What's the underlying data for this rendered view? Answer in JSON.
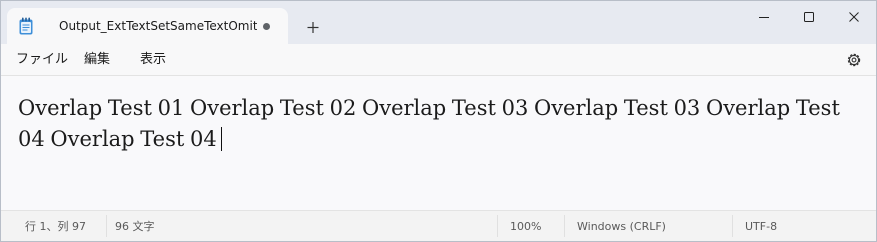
{
  "window": {
    "tab_title": "Output_ExtTextSetSameTextOmitRa",
    "new_tab_symbol": "+",
    "modified_indicator": "unsaved-dot"
  },
  "menu": {
    "items": [
      "ファイル",
      "編集",
      "表示"
    ]
  },
  "editor": {
    "content": "Overlap Test 01 Overlap Test 02 Overlap Test 03 Overlap Test 03 Overlap Test 04 Overlap Test 04"
  },
  "status": {
    "position": "行 1、列 97",
    "char_count": "96 文字",
    "zoom": "100%",
    "line_ending": "Windows (CRLF)",
    "encoding": "UTF-8"
  },
  "icons": {
    "app": "notepad-icon",
    "minimize": "minimize-icon",
    "maximize": "maximize-icon",
    "close": "close-icon",
    "settings": "gear-icon"
  },
  "colors": {
    "titlebar": "#e7eaf1",
    "tab": "#f8f8f9",
    "editor_bg": "#f9f9fb",
    "statusbar": "#f3f3f3"
  }
}
